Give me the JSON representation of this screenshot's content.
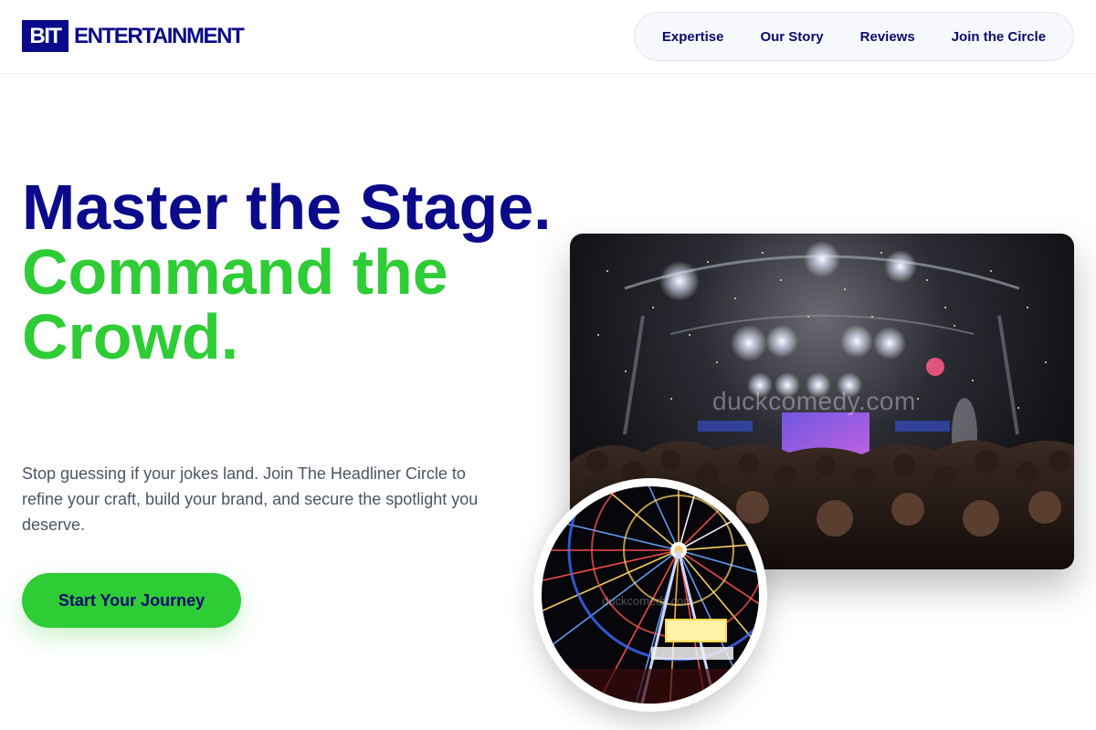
{
  "brand": {
    "box_text": "BIT",
    "name": "ENTERTAINMENT",
    "primary_color": "#0a0a8a",
    "accent_color": "#2ecc35"
  },
  "nav": {
    "items": [
      {
        "label": "Expertise"
      },
      {
        "label": "Our Story"
      },
      {
        "label": "Reviews"
      },
      {
        "label": "Join the Circle"
      }
    ]
  },
  "hero": {
    "headline_line1": "Master the Stage.",
    "headline_line2": "Command the Crowd.",
    "subtext": "Stop guessing if your jokes land. Join The Headliner Circle to refine your craft, build your brand, and secure the spotlight you deserve.",
    "cta_label": "Start Your Journey"
  },
  "images": {
    "concert_watermark": "duckcomedy.com",
    "ferris_watermark": "duckcomedy.com"
  }
}
